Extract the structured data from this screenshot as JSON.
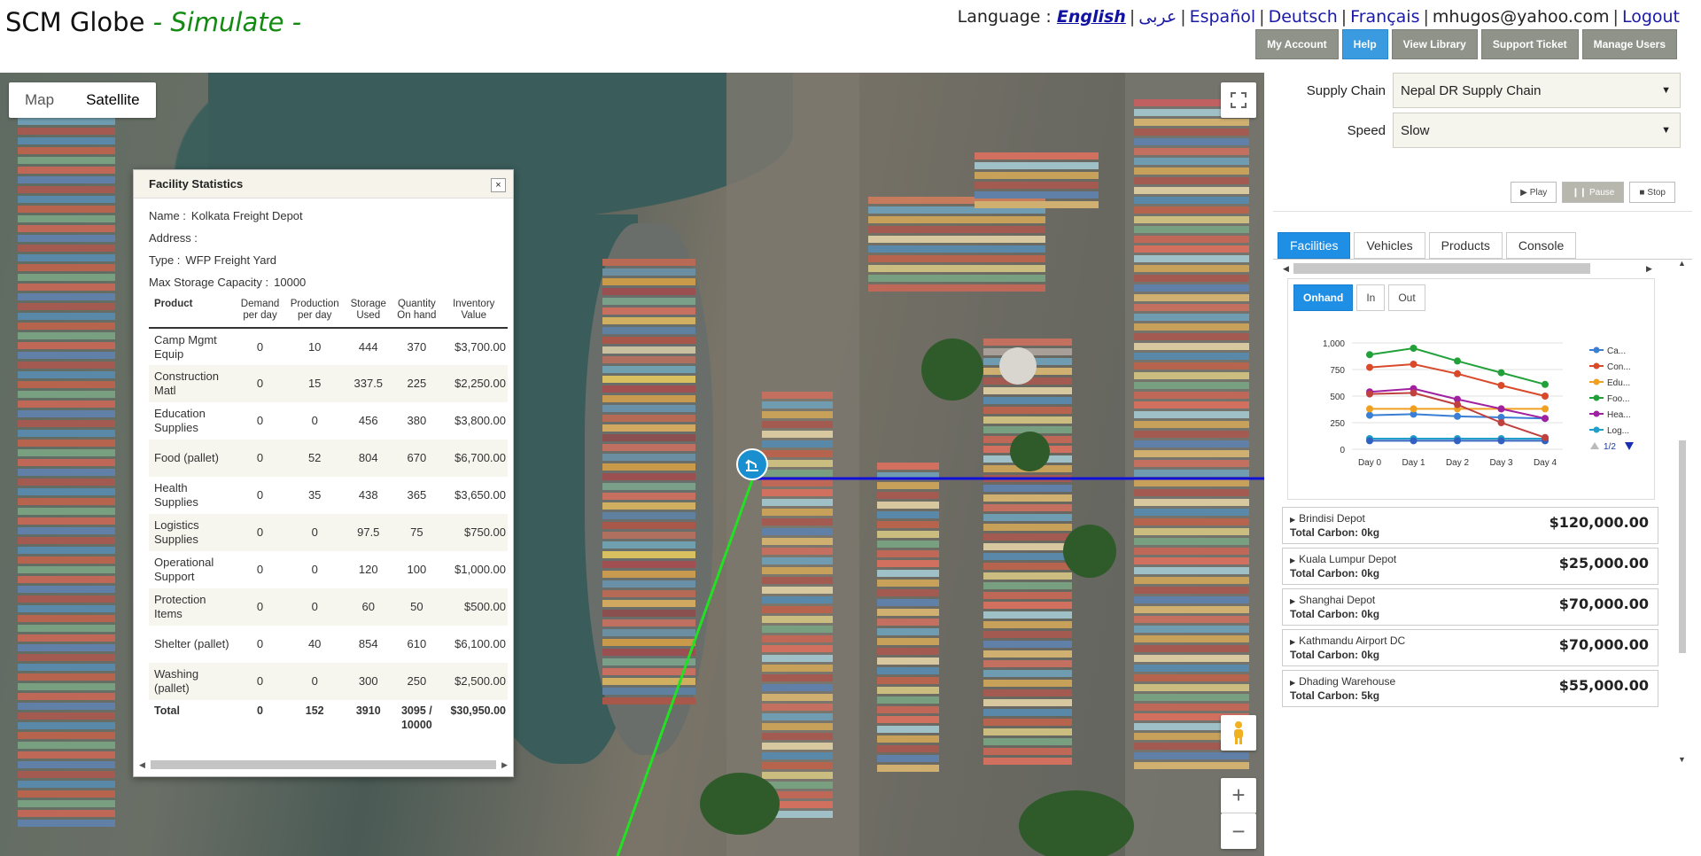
{
  "app": {
    "brand": "SCM Globe",
    "mode": " - Simulate -"
  },
  "lang": {
    "label": "Language : ",
    "english": "English",
    "arabic": "عربى",
    "espanol": "Español",
    "deutsch": "Deutsch",
    "francais": "Français",
    "account": "mhugos@yahoo.com",
    "logout": "Logout"
  },
  "top_buttons": {
    "my_account": "My Account",
    "help": "Help",
    "view_library": "View Library",
    "support_ticket": "Support Ticket",
    "manage_users": "Manage Users"
  },
  "map": {
    "map_label": "Map",
    "satellite_label": "Satellite",
    "zoom_in": "+",
    "zoom_out": "−"
  },
  "facility": {
    "title": "Facility Statistics",
    "close": "×",
    "name_label": "Name :",
    "name": "Kolkata Freight Depot",
    "address_label": "Address :",
    "address": "",
    "type_label": "Type :",
    "type": "WFP Freight Yard",
    "cap_label": "Max Storage Capacity :",
    "cap": "10000",
    "headers": {
      "product": "Product",
      "demand": "Demand per day",
      "production": "Production per day",
      "storage": "Storage Used",
      "quantity": "Quantity On hand",
      "value": "Inventory Value"
    },
    "rows": [
      {
        "product": "Camp Mgmt Equip",
        "demand": "0",
        "production": "10",
        "storage": "444",
        "quantity": "370",
        "value": "$3,700.00"
      },
      {
        "product": "Construction Matl",
        "demand": "0",
        "production": "15",
        "storage": "337.5",
        "quantity": "225",
        "value": "$2,250.00"
      },
      {
        "product": "Education Supplies",
        "demand": "0",
        "production": "0",
        "storage": "456",
        "quantity": "380",
        "value": "$3,800.00"
      },
      {
        "product": "Food (pallet)",
        "demand": "0",
        "production": "52",
        "storage": "804",
        "quantity": "670",
        "value": "$6,700.00"
      },
      {
        "product": "Health Supplies",
        "demand": "0",
        "production": "35",
        "storage": "438",
        "quantity": "365",
        "value": "$3,650.00"
      },
      {
        "product": "Logistics Supplies",
        "demand": "0",
        "production": "0",
        "storage": "97.5",
        "quantity": "75",
        "value": "$750.00"
      },
      {
        "product": "Operational Support",
        "demand": "0",
        "production": "0",
        "storage": "120",
        "quantity": "100",
        "value": "$1,000.00"
      },
      {
        "product": "Protection Items",
        "demand": "0",
        "production": "0",
        "storage": "60",
        "quantity": "50",
        "value": "$500.00"
      },
      {
        "product": "Shelter (pallet)",
        "demand": "0",
        "production": "40",
        "storage": "854",
        "quantity": "610",
        "value": "$6,100.00"
      },
      {
        "product": "Washing (pallet)",
        "demand": "0",
        "production": "0",
        "storage": "300",
        "quantity": "250",
        "value": "$2,500.00"
      }
    ],
    "total": {
      "product": "Total",
      "demand": "0",
      "production": "152",
      "storage": "3910",
      "quantity": "3095 / 10000",
      "value": "$30,950.00"
    }
  },
  "panel": {
    "supply_chain_label": "Supply Chain",
    "supply_chain": "Nepal DR Supply Chain",
    "speed_label": "Speed",
    "speed": "Slow",
    "play": "Play",
    "pause": "Pause",
    "stop": "Stop",
    "tabs": {
      "facilities": "Facilities",
      "vehicles": "Vehicles",
      "products": "Products",
      "console": "Console"
    },
    "subtabs": {
      "onhand": "Onhand",
      "in": "In",
      "out": "Out"
    },
    "legend_page": "1/2",
    "depots": [
      {
        "name": "Brindisi Depot",
        "carbon": "Total Carbon: 0kg",
        "amount": "$120,000.00"
      },
      {
        "name": "Kuala Lumpur Depot",
        "carbon": "Total Carbon: 0kg",
        "amount": "$25,000.00"
      },
      {
        "name": "Shanghai Depot",
        "carbon": "Total Carbon: 0kg",
        "amount": "$70,000.00"
      },
      {
        "name": "Kathmandu Airport DC",
        "carbon": "Total Carbon: 0kg",
        "amount": "$70,000.00"
      },
      {
        "name": "Dhading Warehouse",
        "carbon": "Total Carbon: 5kg",
        "amount": "$55,000.00"
      }
    ]
  },
  "chart_data": {
    "type": "line",
    "categories": [
      "Day 0",
      "Day 1",
      "Day 2",
      "Day 3",
      "Day 4"
    ],
    "ylim": [
      0,
      1000
    ],
    "yticks": [
      "0",
      "250",
      "500",
      "750",
      "1,000"
    ],
    "legend_position": "right",
    "grid": true,
    "series": [
      {
        "name": "Ca...",
        "color": "#3a7fd5",
        "values": [
          320,
          330,
          310,
          300,
          290
        ]
      },
      {
        "name": "Con...",
        "color": "#d94a2b",
        "values": [
          770,
          800,
          710,
          600,
          500
        ]
      },
      {
        "name": "Edu...",
        "color": "#f0a020",
        "values": [
          380,
          380,
          380,
          380,
          380
        ]
      },
      {
        "name": "Foo...",
        "color": "#22a03a",
        "values": [
          890,
          950,
          830,
          720,
          610
        ]
      },
      {
        "name": "Hea...",
        "color": "#a020a0",
        "values": [
          540,
          570,
          470,
          380,
          290
        ]
      },
      {
        "name": "Log...",
        "color": "#20a0c8",
        "values": [
          100,
          100,
          100,
          100,
          100
        ]
      },
      {
        "name": "",
        "color": "#3060c0",
        "values": [
          80,
          80,
          80,
          80,
          80
        ]
      },
      {
        "name": "",
        "color": "#c04040",
        "values": [
          520,
          530,
          420,
          250,
          110
        ]
      }
    ]
  }
}
